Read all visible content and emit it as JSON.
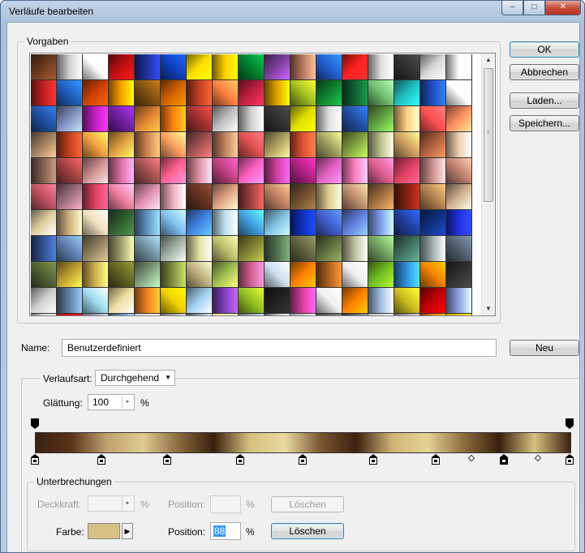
{
  "window": {
    "title": "Verläufe bearbeiten",
    "controls": [
      "–",
      "□",
      "✕"
    ]
  },
  "presets": {
    "group_label": "Vorgaben",
    "columns": 17,
    "swatches": [
      [
        "#6b3a1e",
        "#cfcfcf",
        "#ffffff",
        "#c01010",
        "#2030a0",
        "#1040c0",
        "#ffe000",
        "#ffd000",
        "#008030",
        "#8040a0",
        "#b87860",
        "#2060d0",
        "#ff2020",
        "#e0e0e0",
        "#303030",
        "#d8d8d8",
        "#ffffff"
      ],
      [
        "#c02020",
        "#2060c0",
        "#d04000",
        "#ffa000",
        "#805010",
        "#d06000",
        "#c04020",
        "#ff8040",
        "#c02040",
        "#e0a000",
        "#a0c020",
        "#108030",
        "#106030",
        "#70c070",
        "#20c0c0",
        "#2050c0",
        "#ffffff"
      ],
      [
        "#2050a0",
        "#8090c0",
        "#c020c0",
        "#7020a0",
        "#e08030",
        "#ff8010",
        "#a03030",
        "#c0c0c0",
        "#d0d0d0",
        "#303030",
        "#e0e000",
        "#e0e0e0",
        "#2050a0",
        "#60a040",
        "#ffd080",
        "#ff5050",
        "#ff9060"
      ],
      [
        "#a08060",
        "#c04020",
        "#f0a040",
        "#e0a040",
        "#d08050",
        "#ffa060",
        "#a05050",
        "#c08060",
        "#e05050",
        "#b0a060",
        "#e05030",
        "#a0a060",
        "#80a040",
        "#c0c090",
        "#d0a060",
        "#b06040",
        "#f0d0b0"
      ],
      [
        "#806050",
        "#a04040",
        "#d09090",
        "#e070a0",
        "#a05050",
        "#ff6090",
        "#e090a0",
        "#c04080",
        "#ff60c0",
        "#d040a0",
        "#b02080",
        "#e060c0",
        "#ff80c0",
        "#e06090",
        "#e04060",
        "#d09090",
        "#c08070"
      ],
      [
        "#c05060",
        "#a07080",
        "#e04060",
        "#f080a0",
        "#e090b0",
        "#f0b0c0",
        "#603020",
        "#e0a080",
        "#a04040",
        "#c08060",
        "#705030",
        "#e0d090",
        "#c09070",
        "#a07040",
        "#802010",
        "#b08050",
        "#d0b090"
      ],
      [
        "#e0d0a0",
        "#d0b080",
        "#f0e0c0",
        "#306030",
        "#6090c0",
        "#80c0f0",
        "#4080e0",
        "#c0e0f0",
        "#40a0e0",
        "#80c0e0",
        "#1030c0",
        "#4060d0",
        "#6080e0",
        "#80a0f0",
        "#2040a0",
        "#103080",
        "#2030e0"
      ],
      [
        "#305090",
        "#6080b0",
        "#908060",
        "#a0a070",
        "#7090a0",
        "#a0b0a0",
        "#e0e0a0",
        "#c0c070",
        "#808030",
        "#507050",
        "#606040",
        "#607040",
        "#c0c0a0",
        "#70a060",
        "#407060",
        "#a0b0b0",
        "#506070"
      ],
      [
        "#506030",
        "#c0a030",
        "#d0b050",
        "#606020",
        "#80a080",
        "#809040",
        "#c0b080",
        "#a0c050",
        "#d06090",
        "#d0e0f0",
        "#ff8000",
        "#b06020",
        "#f0f0f0",
        "#70c020",
        "#3090e0",
        "#f08000",
        "#303030"
      ],
      [
        "#d0d0d0",
        "#6080a0",
        "#a0e0f0",
        "#f0e0a0",
        "#f08020",
        "#f0d000",
        "#a0d0f0",
        "#8040c0",
        "#90c020",
        "#202020",
        "#e040a0",
        "#f0f0f0",
        "#ff8000",
        "#a0c0e0",
        "#d0c020",
        "#c00000",
        "#90a0e0"
      ],
      [
        "#e0e0e0",
        "#c00000",
        "#d0e0f0",
        "#6090c0",
        "#d0d0d0",
        "#e0e0e0",
        "#90a0a0",
        "#ffe080",
        "#d0e0f0",
        "#c0c0c0",
        "#a0a0a0",
        "#808080",
        "#606060",
        "#c0c0c0",
        "#e0e0e0",
        "#ff8000",
        "#d0a000"
      ]
    ]
  },
  "buttons": {
    "ok": "OK",
    "cancel": "Abbrechen",
    "load": "Laden...",
    "save": "Speichern...",
    "new": "Neu"
  },
  "name_field": {
    "label": "Name:",
    "value": "Benutzerdefiniert"
  },
  "gradient": {
    "type_label": "Verlaufsart:",
    "type_value": "Durchgehend",
    "smoothness_label": "Glättung:",
    "smoothness_value": "100",
    "smoothness_unit": "%",
    "colors": [
      "#3a2010",
      "#5a3418",
      "#c0a070",
      "#e0cc90",
      "#8a6a40",
      "#3a1f0c",
      "#d8c080",
      "#e8d8a0",
      "#7a5530",
      "#3c200e",
      "#d0b478",
      "#e6d294",
      "#8c6c40",
      "#3a1f0c",
      "#d8c080",
      "#3c2010"
    ]
  },
  "stops_group": {
    "label": "Unterbrechungen",
    "opacity_label": "Deckkraft:",
    "opacity_unit": "%",
    "position_label_1": "Position:",
    "position_unit_1": "%",
    "delete_1": "Löschen",
    "color_label": "Farbe:",
    "color_value": "#d8c084",
    "position_label_2": "Position:",
    "position_value_2": "88",
    "position_unit_2": "%",
    "delete_2": "Löschen"
  }
}
